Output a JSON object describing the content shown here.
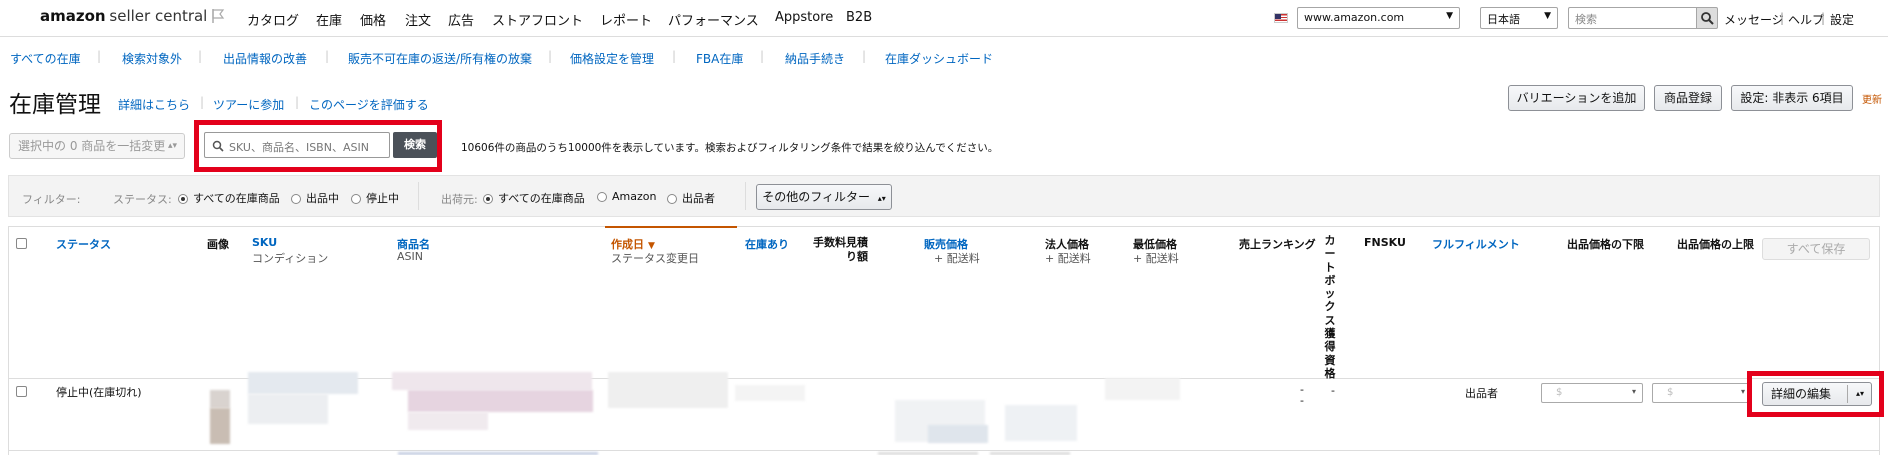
{
  "topnav": {
    "logo_main": "amazon",
    "logo_sub": "seller central",
    "items": [
      "カタログ",
      "在庫",
      "価格",
      "注文",
      "広告",
      "ストアフロント",
      "レポート",
      "パフォーマンス",
      "Appstore",
      "B2B"
    ],
    "marketplace": "www.amazon.com",
    "language": "日本語",
    "search_placeholder": "検索",
    "links": [
      "メッセージ",
      "ヘルプ",
      "設定"
    ]
  },
  "subnav": [
    "すべての在庫",
    "検索対象外",
    "出品情報の改善",
    "販売不可在庫の返送/所有権の放棄",
    "価格設定を管理",
    "FBA在庫",
    "納品手続き",
    "在庫ダッシュボード"
  ],
  "page": {
    "title": "在庫管理",
    "links": [
      "詳細はこちら",
      "ツアーに参加",
      "このページを評価する"
    ],
    "buttons": {
      "add_variation": "バリエーションを追加",
      "add_product": "商品登録",
      "settings": "設定: 非表示 6項目"
    },
    "refresh": "更新"
  },
  "toolbar": {
    "bulk_action": "選択中の 0 商品を一括変更",
    "search_placeholder": "SKU、商品名、ISBN、ASIN",
    "search_button": "検索",
    "result_text": "10606件の商品のうち10000件を表示しています。検索およびフィルタリング条件で結果を絞り込んでください。"
  },
  "filters": {
    "label": "フィルター:",
    "status_label": "ステータス:",
    "status_options": [
      "すべての在庫商品",
      "出品中",
      "停止中"
    ],
    "status_selected": 0,
    "fulfillment_label": "出荷元:",
    "fulfillment_options": [
      "すべての在庫商品",
      "Amazon",
      "出品者"
    ],
    "fulfillment_selected": 0,
    "more_filters": "その他のフィルター"
  },
  "table": {
    "headers": {
      "status": "ステータス",
      "image": "画像",
      "sku": "SKU",
      "condition": "コンディション",
      "product_name": "商品名",
      "asin": "ASIN",
      "created": "作成日",
      "status_changed": "ステータス変更日",
      "available": "在庫あり",
      "fee_estimate": "手数料見積り額",
      "price": "販売価格",
      "price_sub": "+ 配送料",
      "business_price": "法人価格",
      "business_sub": "+ 配送料",
      "lowest_price": "最低価格",
      "lowest_sub": "+ 配送料",
      "sales_rank": "売上ランキング",
      "buybox": "カートボックス獲得資格",
      "fnsku": "FNSKU",
      "fulfillment": "フルフィルメント",
      "min_price": "出品価格の下限",
      "max_price": "出品価格の上限",
      "save_all": "すべて保存"
    },
    "rows": [
      {
        "status": "停止中(在庫切れ)",
        "sales_rank": "-\n-",
        "buybox": "-",
        "fulfillment": "出品者",
        "min_price_placeholder": "$",
        "max_price_placeholder": "$",
        "action": "詳細の編集"
      }
    ]
  },
  "colors": {
    "link": "#0066c0",
    "highlight_red": "#e3001b",
    "sort_orange": "#c45500"
  }
}
